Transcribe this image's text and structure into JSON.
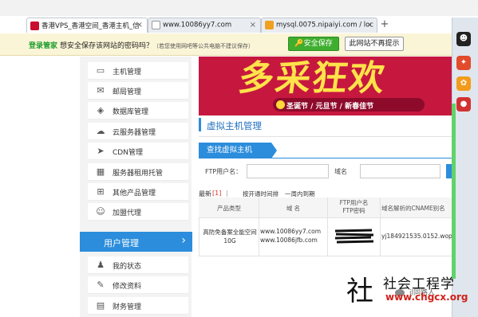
{
  "browser": {
    "tabs": [
      {
        "label": "香港VPS_香港空间_香港主机_信",
        "active": true
      },
      {
        "label": "www.10086yy7.com",
        "active": false
      },
      {
        "label": "mysql.0075.nipaiyi.com / loc",
        "active": false
      }
    ],
    "new_tab": "+"
  },
  "password_bar": {
    "manager": "登录管家",
    "question": "想安全保存该网站的密码吗？",
    "note": "（若您使用网吧等公共电脑不建议保存）",
    "save_button": "安全保存",
    "never_button": "此网站不再提示"
  },
  "sidebar": {
    "items": [
      {
        "label": "主机管理",
        "icon": "monitor-icon"
      },
      {
        "label": "邮局管理",
        "icon": "mail-icon"
      },
      {
        "label": "数据库管理",
        "icon": "database-icon"
      },
      {
        "label": "云服务器管理",
        "icon": "cloud-icon"
      },
      {
        "label": "CDN管理",
        "icon": "cursor-icon"
      },
      {
        "label": "服务器租用托管",
        "icon": "server-icon"
      },
      {
        "label": "其他产品管理",
        "icon": "plus-box-icon"
      },
      {
        "label": "加盟代理",
        "icon": "add-user-icon"
      }
    ],
    "user_section": {
      "label": "用户管理",
      "arrow": "›"
    },
    "user_items": [
      {
        "label": "我的状态",
        "icon": "user-icon"
      },
      {
        "label": "修改资料",
        "icon": "edit-icon"
      },
      {
        "label": "财务管理",
        "icon": "finance-icon"
      }
    ]
  },
  "banner": {
    "headline": "多采狂欢",
    "subline": "圣诞节 / 元旦节 / 新春佳节"
  },
  "main": {
    "section_title": "虚拟主机管理",
    "search_tab": "查找虚拟主机",
    "ftp_label": "FTP用户名：",
    "domain_label": "域名",
    "filters": {
      "latest": "最新",
      "count": "[1]",
      "separator": "|",
      "expire": "按开通时间排",
      "week": "一周内到期"
    },
    "table": {
      "headers": [
        "产品类型",
        "域  名",
        "FTP用户名\nFTP密码",
        "域名解析的CNAME别名"
      ],
      "rows": [
        {
          "product": "高防免备案全能空间10G",
          "domains": [
            "www.10086yy7.com",
            "www.10086jfb.com"
          ],
          "cname": "yj184921535.0152.wop"
        }
      ]
    }
  },
  "watermark": {
    "char": "社",
    "name": "社会工程学",
    "sub": "il同路人",
    "url": "www.chgcx.org"
  },
  "colors": {
    "accent": "#2b8ddc",
    "banner": "#c6183f",
    "save_green": "#3fae2f",
    "password_bar": "#fbf5d7"
  }
}
